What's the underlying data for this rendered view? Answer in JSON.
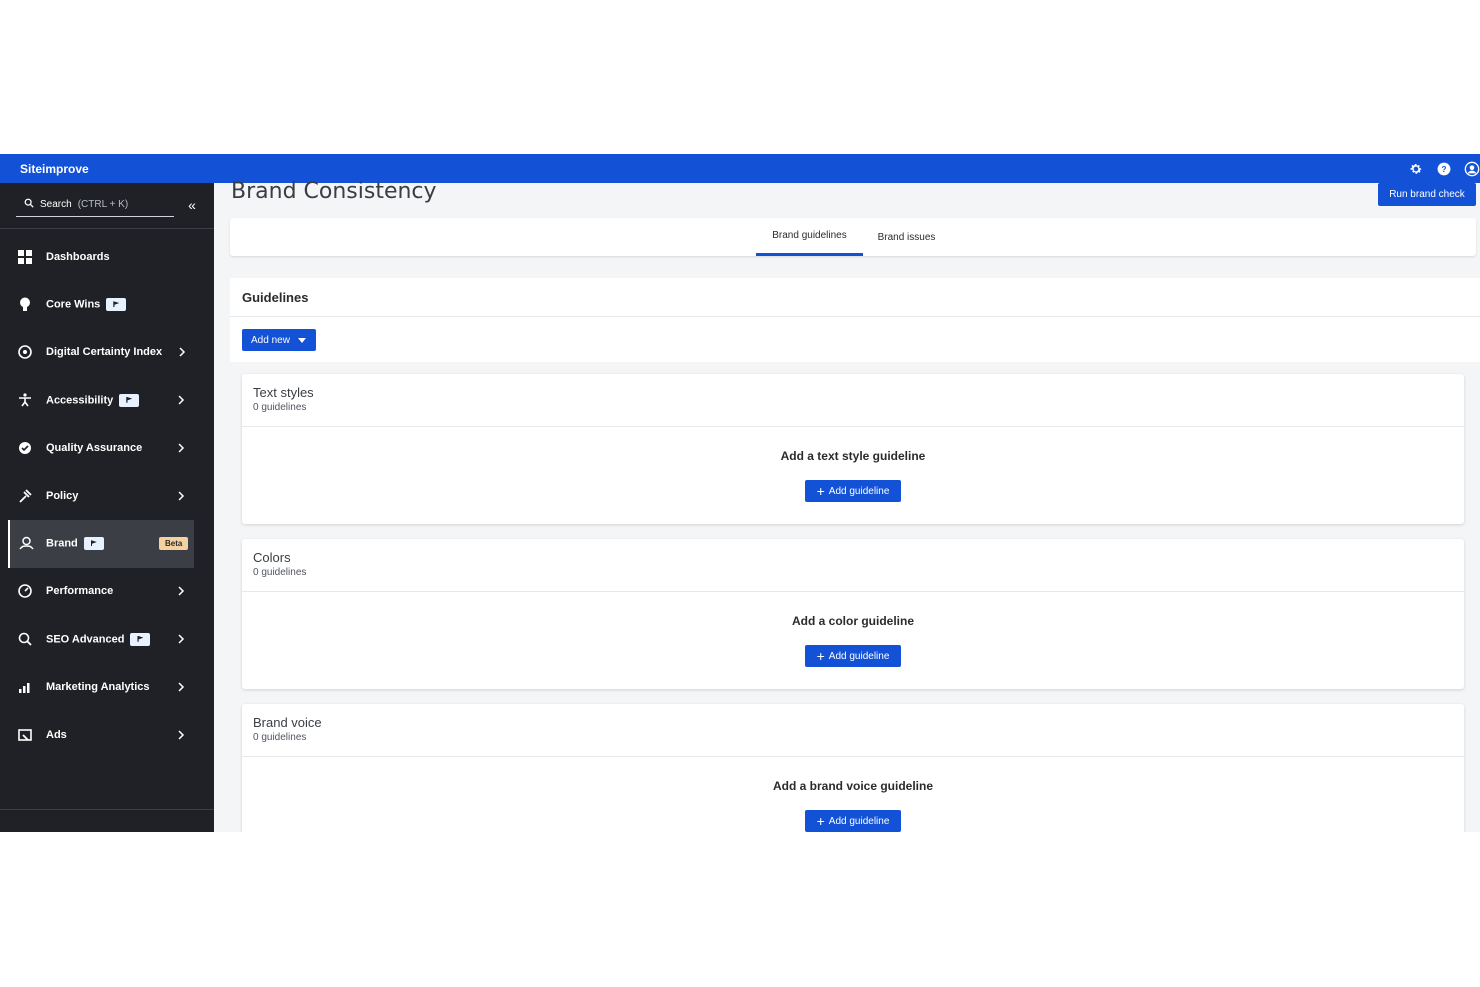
{
  "app": {
    "name": "Siteimprove"
  },
  "topbar": {
    "icons": [
      "gear-icon",
      "help-icon",
      "user-icon"
    ]
  },
  "sidebar": {
    "search": {
      "label": "Search",
      "shortcut": "(CTRL + K)"
    },
    "collapse_icon": "double-chevron-left-icon",
    "items": [
      {
        "label": "Dashboards",
        "icon": "dashboards-icon"
      },
      {
        "label": "Core Wins",
        "icon": "lightbulb-icon"
      },
      {
        "label": "Digital Certainty Index",
        "icon": "dci-icon"
      },
      {
        "label": "Accessibility",
        "icon": "accessibility-icon"
      },
      {
        "label": "Quality Assurance",
        "icon": "quality-icon"
      },
      {
        "label": "Policy",
        "icon": "policy-icon"
      },
      {
        "label": "Brand",
        "icon": "brand-icon",
        "badge": "Beta"
      },
      {
        "label": "Performance",
        "icon": "gauge-icon"
      },
      {
        "label": "SEO Advanced",
        "icon": "seo-icon"
      },
      {
        "label": "Marketing Analytics",
        "icon": "analytics-icon"
      },
      {
        "label": "Ads",
        "icon": "ads-icon"
      }
    ]
  },
  "main": {
    "title": "Brand Consistency",
    "run_button": "Run brand check",
    "tabs": [
      {
        "label": "Brand guidelines",
        "active": true
      },
      {
        "label": "Brand issues",
        "active": false
      }
    ],
    "panel": {
      "title": "Guidelines",
      "add_new": "Add new",
      "cards": [
        {
          "title": "Text styles",
          "count": "0 guidelines",
          "empty": "Add a text style guideline",
          "button": "Add guideline"
        },
        {
          "title": "Colors",
          "count": "0 guidelines",
          "empty": "Add a color guideline",
          "button": "Add guideline"
        },
        {
          "title": "Brand voice",
          "count": "0 guidelines",
          "empty": "Add a brand voice guideline",
          "button": "Add guideline"
        }
      ]
    }
  },
  "colors": {
    "primary": "#1352d6",
    "sidebar": "#1f2126",
    "active_item": "#3b3e45",
    "beta_badge": "#f6d1a0"
  }
}
